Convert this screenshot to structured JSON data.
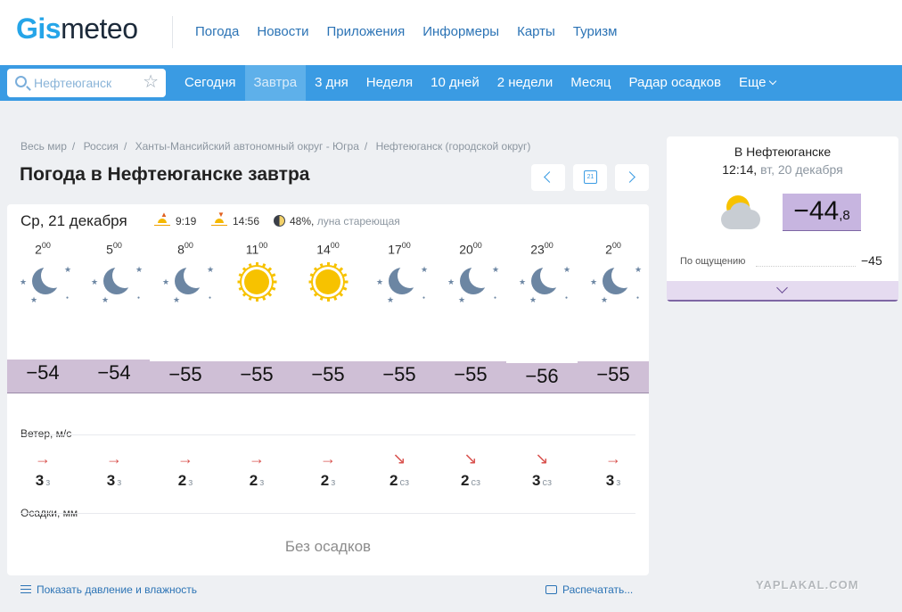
{
  "header": {
    "logo_gis": "Gis",
    "logo_meteo": "meteo",
    "nav": [
      "Погода",
      "Новости",
      "Приложения",
      "Информеры",
      "Карты",
      "Туризм"
    ]
  },
  "search": {
    "placeholder": "Нефтеюганск"
  },
  "tabs": [
    "Сегодня",
    "Завтра",
    "3 дня",
    "Неделя",
    "10 дней",
    "2 недели",
    "Месяц",
    "Радар осадков",
    "Еще"
  ],
  "active_tab": "Завтра",
  "breadcrumb": [
    "Весь мир",
    "Россия",
    "Ханты-Мансийский автономный округ - Югра",
    "Нефтеюганск (городской округ)"
  ],
  "page_title": "Погода в Нефтеюганске завтра",
  "calendar_day": "21",
  "day": {
    "date": "Ср, 21 декабря",
    "sunrise": "9:19",
    "sunset": "14:56",
    "moon_percent": "48%",
    "moon_phase": "луна стареющая"
  },
  "hours": [
    {
      "h": "2",
      "m": "00",
      "icon": "moon-stars-icon",
      "temp": "−54",
      "wind_dir_icon": "arrow-right",
      "wind_speed": "3",
      "wind_dir": "з"
    },
    {
      "h": "5",
      "m": "00",
      "icon": "moon-stars-icon",
      "temp": "−54",
      "wind_dir_icon": "arrow-right",
      "wind_speed": "3",
      "wind_dir": "з"
    },
    {
      "h": "8",
      "m": "00",
      "icon": "moon-stars-icon",
      "temp": "−55",
      "wind_dir_icon": "arrow-right",
      "wind_speed": "2",
      "wind_dir": "з"
    },
    {
      "h": "11",
      "m": "00",
      "icon": "sun-icon",
      "temp": "−55",
      "wind_dir_icon": "arrow-right",
      "wind_speed": "2",
      "wind_dir": "з"
    },
    {
      "h": "14",
      "m": "00",
      "icon": "sun-icon",
      "temp": "−55",
      "wind_dir_icon": "arrow-right",
      "wind_speed": "2",
      "wind_dir": "з"
    },
    {
      "h": "17",
      "m": "00",
      "icon": "moon-stars-icon",
      "temp": "−55",
      "wind_dir_icon": "arrow-down-right",
      "wind_speed": "2",
      "wind_dir": "сз"
    },
    {
      "h": "20",
      "m": "00",
      "icon": "moon-stars-icon",
      "temp": "−55",
      "wind_dir_icon": "arrow-down-right",
      "wind_speed": "2",
      "wind_dir": "сз"
    },
    {
      "h": "23",
      "m": "00",
      "icon": "moon-stars-icon",
      "temp": "−56",
      "wind_dir_icon": "arrow-down-right",
      "wind_speed": "3",
      "wind_dir": "сз"
    },
    {
      "h": "2",
      "m": "00",
      "icon": "moon-stars-icon",
      "temp": "−55",
      "wind_dir_icon": "arrow-right",
      "wind_speed": "3",
      "wind_dir": "з"
    }
  ],
  "wind_label": "Ветер, м/с",
  "precip_label": "Осадки, мм",
  "precip_value": "Без осадков",
  "side": {
    "city": "В Нефтеюганске",
    "time": "12:14,",
    "date": "вт, 20 декабря",
    "temp_int": "−44",
    "temp_dec": ",8",
    "feels_label": "По ощущению",
    "feels_value": "−45"
  },
  "footer": {
    "pressure_link": "Показать давление и влажность",
    "print_link": "Распечатать..."
  },
  "watermark": "YAPLAKAL.COM",
  "colors": {
    "brand_blue": "#3a9be3",
    "link": "#2b73b5",
    "temp_band": "#cfbfd6",
    "current_temp_band": "#c7b5e0",
    "wind_arrow": "#d9534f",
    "sun": "#f7c200",
    "moon": "#6c86a3"
  }
}
